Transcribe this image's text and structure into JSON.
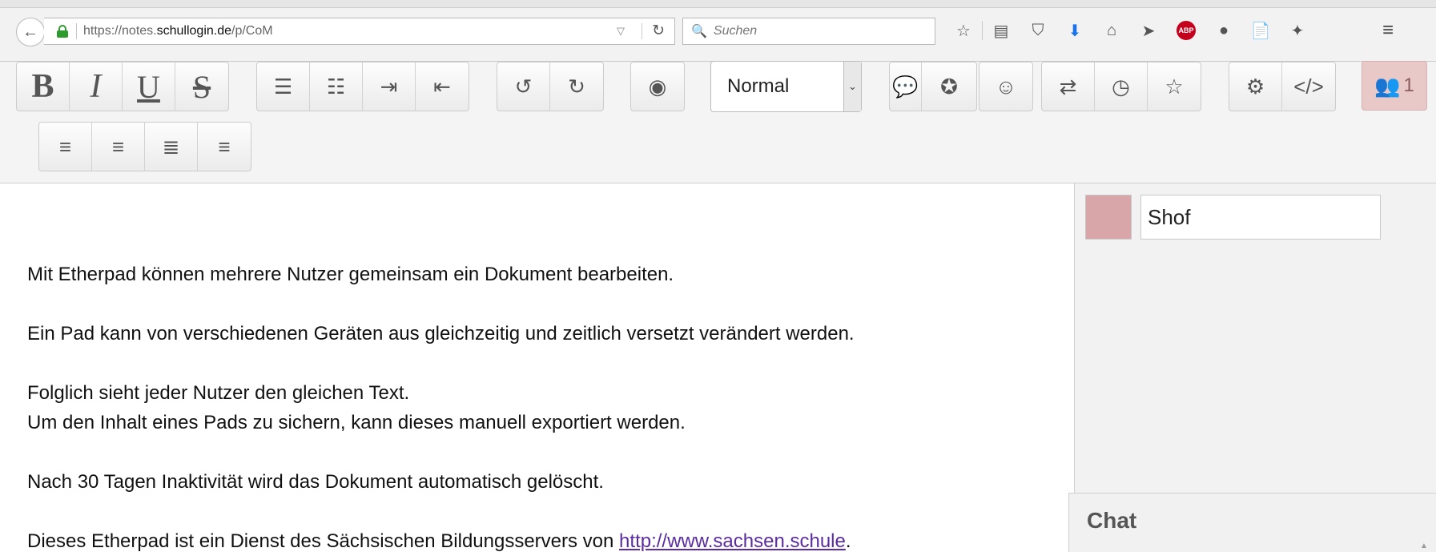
{
  "browser": {
    "url_prefix": "https://notes.",
    "url_host": "schullogin.de",
    "url_path": "/p/CoM",
    "search_placeholder": "Suchen",
    "back_symbol": "←",
    "reload_symbol": "↻",
    "dropdown_symbol": "▽",
    "search_symbol": "🔍",
    "menu_symbol": "≡",
    "toolbar_icons": [
      {
        "name": "bookmark-star-icon",
        "glyph": "☆"
      },
      {
        "name": "reading-list-icon",
        "glyph": "▤"
      },
      {
        "name": "pocket-icon",
        "glyph": "⛉"
      },
      {
        "name": "downloads-icon",
        "glyph": "⬇"
      },
      {
        "name": "home-icon",
        "glyph": "⌂"
      },
      {
        "name": "send-icon",
        "glyph": "➤"
      },
      {
        "name": "adblock-icon",
        "glyph": "ABP"
      },
      {
        "name": "chat-bubble-icon",
        "glyph": "●"
      },
      {
        "name": "pdf-icon",
        "glyph": "📄"
      },
      {
        "name": "extension-icon",
        "glyph": "✦"
      }
    ]
  },
  "editbar": {
    "format_buttons": [
      {
        "name": "bold-button",
        "glyph": "B"
      },
      {
        "name": "italic-button",
        "glyph": "I"
      },
      {
        "name": "underline-button",
        "glyph": "U"
      },
      {
        "name": "strikethrough-button",
        "glyph": "S"
      }
    ],
    "list_buttons": [
      {
        "name": "ordered-list-button",
        "glyph": "☰"
      },
      {
        "name": "unordered-list-button",
        "glyph": "☷"
      },
      {
        "name": "indent-button",
        "glyph": "⇥"
      },
      {
        "name": "outdent-button",
        "glyph": "⇤"
      }
    ],
    "history_buttons": [
      {
        "name": "undo-button",
        "glyph": "↺"
      },
      {
        "name": "redo-button",
        "glyph": "↻"
      }
    ],
    "authorship_glyph": "◉",
    "heading_value": "Normal",
    "heading_arrow": "⌄",
    "comment_glyph": "💬",
    "badge_glyph": "✪",
    "smiley_glyph": "☺",
    "right_buttons": [
      {
        "name": "import-export-button",
        "glyph": "⇄"
      },
      {
        "name": "timeslider-button",
        "glyph": "◷"
      },
      {
        "name": "star-button",
        "glyph": "☆"
      }
    ],
    "settings_buttons": [
      {
        "name": "settings-button",
        "glyph": "⚙"
      },
      {
        "name": "embed-button",
        "glyph": "</>"
      }
    ],
    "users_glyph": "👥",
    "users_count": "1",
    "align_buttons": [
      {
        "name": "align-left-button",
        "glyph": "≡"
      },
      {
        "name": "align-center-button",
        "glyph": "≡"
      },
      {
        "name": "align-justify-button",
        "glyph": "≣"
      },
      {
        "name": "align-right-button",
        "glyph": "≡"
      }
    ]
  },
  "document": {
    "lines": [
      "",
      "Mit Etherpad können mehrere Nutzer gemeinsam ein Dokument bearbeiten.",
      "",
      "Ein Pad kann von verschiedenen Geräten aus gleichzeitig und zeitlich versetzt verändert werden.",
      "",
      "Folglich sieht jeder Nutzer den gleichen Text.",
      "Um den Inhalt eines Pads zu sichern, kann dieses manuell exportiert werden.",
      "",
      "Nach 30 Tagen Inaktivität wird das Dokument automatisch gelöscht.",
      ""
    ],
    "last_line_prefix": "Dieses Etherpad ist ein Dienst des Sächsischen Bildungsservers von ",
    "last_line_link": "http://www.sachsen.schule",
    "last_line_suffix": "."
  },
  "users_panel": {
    "user_color": "#d8a6a8",
    "user_name": "Shof"
  },
  "chat": {
    "title": "Chat"
  }
}
